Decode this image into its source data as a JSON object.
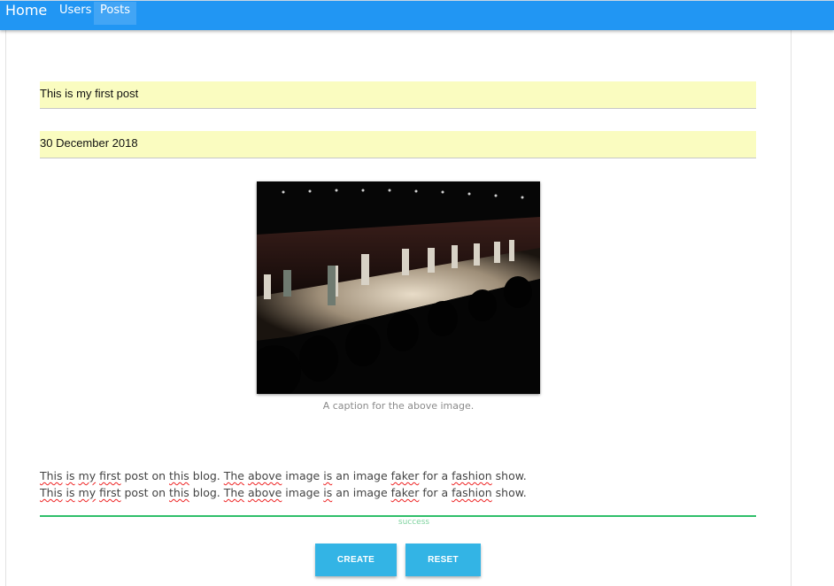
{
  "nav": {
    "home_label": "Home",
    "items": [
      {
        "label": "Users"
      },
      {
        "label": "Posts"
      }
    ]
  },
  "post": {
    "title_value": "This is my first post",
    "date_value": "30 December 2018",
    "image_caption": "A caption for the above image.",
    "body_lines": [
      [
        "This",
        " ",
        "is",
        " ",
        "my",
        " ",
        "first",
        " post on ",
        "this",
        " blog. ",
        "The",
        " ",
        "above",
        " image ",
        "is",
        " an image ",
        "faker",
        " for a ",
        "fashion",
        " show."
      ],
      [
        "This",
        " ",
        "is",
        " ",
        "my",
        " ",
        "first",
        " post on ",
        "this",
        " blog. ",
        "The",
        " ",
        "above",
        " image ",
        "is",
        " an image ",
        "faker",
        " for a ",
        "fashion",
        " show."
      ]
    ],
    "body_status": "success"
  },
  "actions": {
    "create_label": "CREATE",
    "reset_label": "RESET"
  },
  "colors": {
    "navbar": "#2196f3",
    "field_bg": "#fafcc0",
    "success": "#2fbf6a",
    "button": "#33b4e5"
  }
}
